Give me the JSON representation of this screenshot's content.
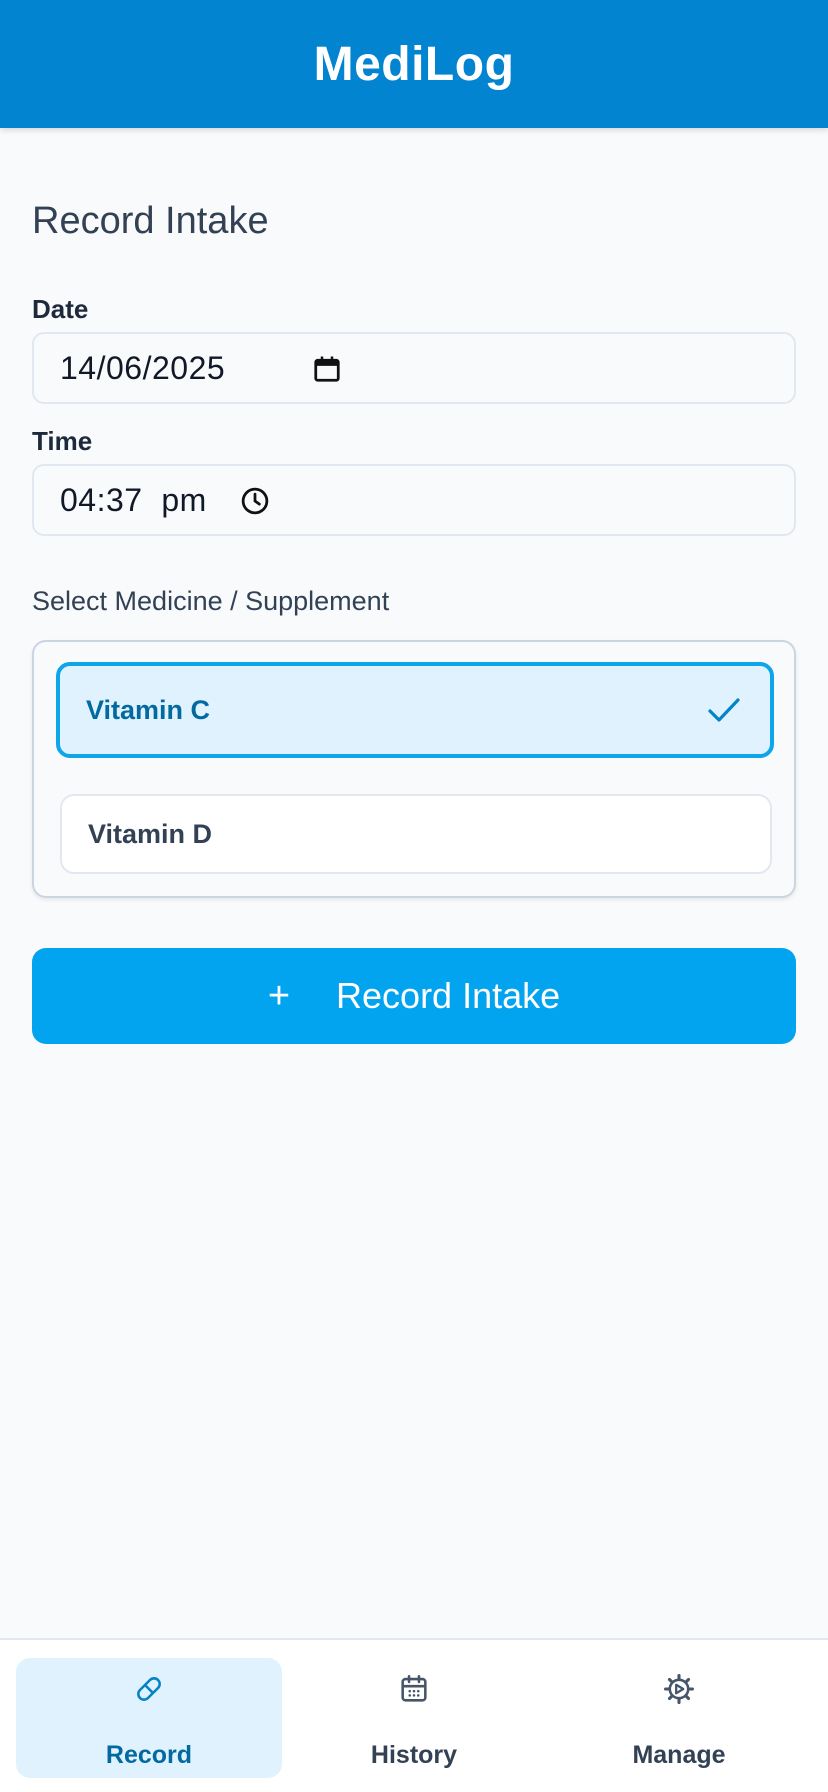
{
  "app": {
    "title": "MediLog"
  },
  "page": {
    "title": "Record Intake"
  },
  "form": {
    "date_label": "Date",
    "date_value": "14/06/2025",
    "time_label": "Time",
    "time_value": "04:37  pm",
    "select_label": "Select Medicine / Supplement",
    "options": [
      {
        "label": "Vitamin C",
        "selected": true
      },
      {
        "label": "Vitamin D",
        "selected": false
      }
    ],
    "submit_icon": "+",
    "submit_label": "Record Intake"
  },
  "nav": {
    "items": [
      {
        "label": "Record",
        "icon": "pill-icon",
        "active": true
      },
      {
        "label": "History",
        "icon": "calendar-icon",
        "active": false
      },
      {
        "label": "Manage",
        "icon": "gear-icon",
        "active": false
      }
    ]
  },
  "colors": {
    "header": "#0284d0",
    "accent": "#03a4ef",
    "selected_border": "#0ea5e9",
    "selected_bg": "#e0f2fe",
    "selected_text": "#0369a1",
    "background": "#f8fafc"
  }
}
